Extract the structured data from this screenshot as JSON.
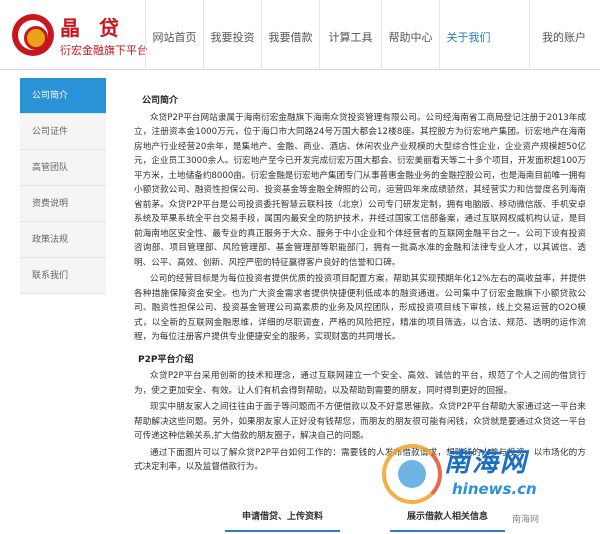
{
  "brand": {
    "title": "晶 贷",
    "subtitle": "衍宏金融旗下平台",
    "primary_color": "#c8161e",
    "accent_color": "#2a92d6"
  },
  "nav": {
    "items": [
      "网站首页",
      "我要投资",
      "我要借款",
      "计算工具",
      "帮助中心",
      "关于我们"
    ],
    "active": "关于我们",
    "account": "我的账户"
  },
  "sidebar": {
    "items": [
      "公司简介",
      "公司证件",
      "高管团队",
      "资费说明",
      "政策法规",
      "联系我们"
    ],
    "active": "公司简介"
  },
  "content": {
    "intro_title": "公司简介",
    "paragraphs": [
      "众贷P2P平台网站隶属于海南衍宏金融旗下海南众贷投资管理有限公司。公司经海南省工商局登记注册于2013年成立，注册资本金1000万元，位于海口市大同路24号万国大都会12楼8座。其控股方为衍宏地产集团。衍宏地产在海南房地产行业经营20余年，是集地产、金融、商业、酒店、休闲农业产业规模的大型综合性企业，企业资产规模超50亿元，企业员工3000余人。衍宏地产至今已开发完成衍宏万国大都会、衍宏美丽看天等二十多个项目，开发面积超100万平方米，土地储备约8000亩。衍宏金融是衍宏地产集团专门从事普惠金融业务的金融控股公司，也是海南目前唯一拥有小额贷款公司、融资性担保公司、投资基金等金融全牌照的公司，运营四年来成绩骄然，其经营实力和信誉度名列海南省前茅。众贷P2P平台是公司投资委托智慧云联科技（北京）公司专门研发定制，拥有电脑版、移动微信版、手机安卓系统及苹果系统全平台交易手段，属国内最安全的防护技术，并经过国家工信部备案，通过互联网权威机构认证，是目前海南地区安全性、最专业的真正服务于大众、服务于中小企业和个体经营者的互联网金融平台之一。公司下设有投资咨询部、项目管理部、风险管理部、基金管理部等职能部门，拥有一批高水准的金融和法律专业人才，以其诚信、透明、公平、高效、创新、风控严密的特征赢得客户良好的信誉和口碑。",
      "公司的经营目标是为每位投资者提供优质的投资项目配置方案，帮助其实现预期年化12%左右的高收益率，并提供各种措施保障资金安全。也为广大资金需求者提供快捷便利低成本的融资通道。公司集中了衍宏金融旗下小额贷款公司、融资性担保公司、投资基金管理公司高素质的业务及风控团队，形成投资项目线下审核，线上交易运营的O2O模式，以全新的互联网金融思维，详细的尽职调查，严格的风险把控，精准的项目筛选，以合法、规范、透明的运作流程，为每位注册客户提供专业便捷安全的服务，实现财富的共同增长。"
    ],
    "platform_title": "P2P平台介绍",
    "platform_paragraphs": [
      "众贷P2P平台采用创新的技术和理念，通过互联网建立一个安全、高效、诚信的平台，规范了个人之间的借贷行为，使之更加安全、有效。让人们有机会得到帮助，以及帮助到需要的朋友，同时得到更好的回报。",
      "现实中朋友家人之间往往由于面子等问题而不方便借款以及不好意思催款。众贷P2P平台帮助大家通过这一平台来帮助解决这些问题。另外，如果朋友家人正好没有钱帮您，而朋友的朋友很可能有闲钱，众贷就是要通过众贷这一平台可传递这种信赖关系,扩大借款的朋友圈子，解决自己的问题。",
      "通过下面图片可以了解众贷P2P平台如何工作的：需要钱的人发布借款请求，想赚钱的人参与投资，以市场化的方式决定利率，以及监督借款行为。"
    ]
  },
  "buttons": {
    "apply": "申请借贷、上传资料",
    "show": "展示借款人相关信息"
  },
  "watermark": {
    "title": "南海网",
    "url": "hinews.cn",
    "tag": "南海网"
  }
}
